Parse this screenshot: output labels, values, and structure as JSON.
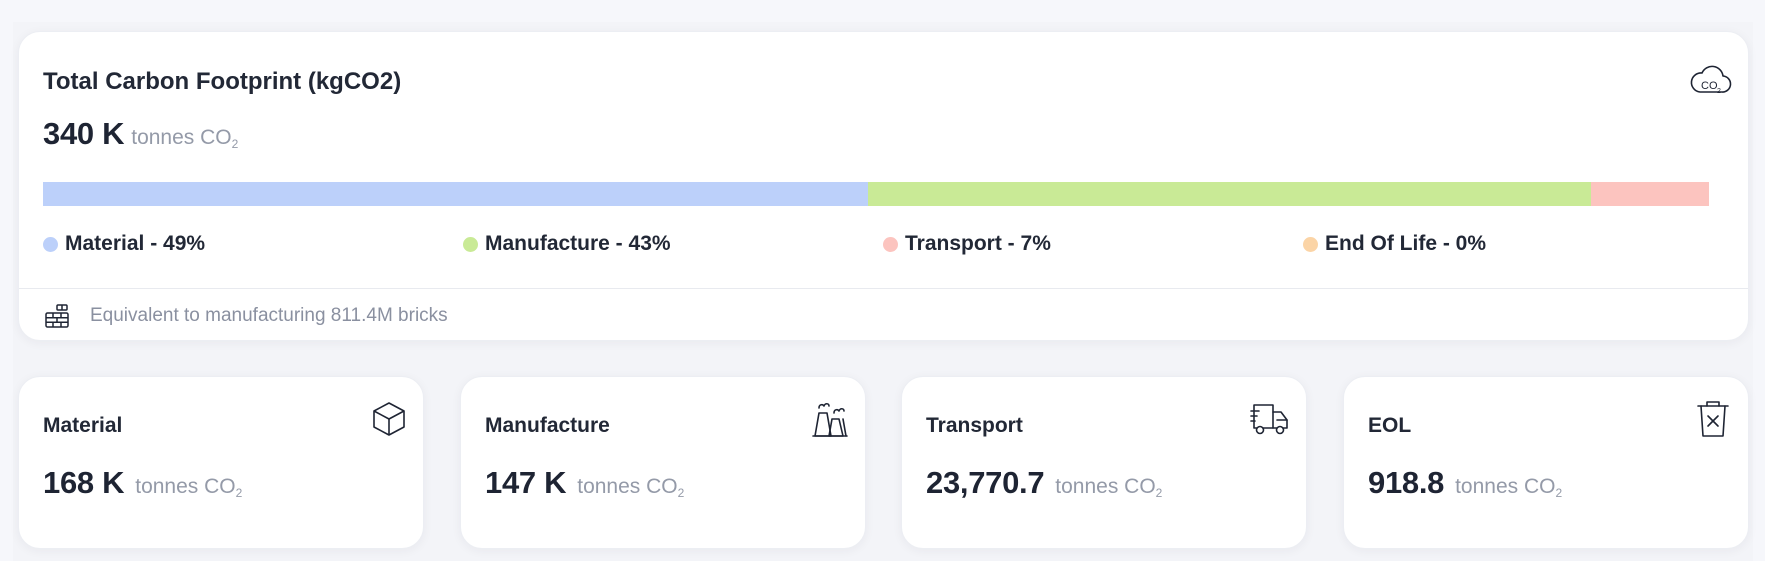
{
  "colors": {
    "material": "#bcd0fa",
    "manufacture": "#c9ea96",
    "transport": "#fcc4bf",
    "end_of_life": "#fbd4a6"
  },
  "total": {
    "title": "Total Carbon Footprint (kgCO2)",
    "icon": "co2-cloud-icon",
    "value": "340 K",
    "unit_prefix": "tonnes CO",
    "unit_sub": "2",
    "breakdown": [
      {
        "label": "Material - 49%",
        "fraction": 0.495,
        "color_key": "material"
      },
      {
        "label": "Manufacture - 43%",
        "fraction": 0.434,
        "color_key": "manufacture"
      },
      {
        "label": "Transport - 7%",
        "fraction": 0.071,
        "color_key": "transport"
      },
      {
        "label": "End Of Life - 0%",
        "fraction": 0.0,
        "color_key": "end_of_life"
      }
    ],
    "footer": {
      "icon": "brick-wall-icon",
      "text": "Equivalent to manufacturing 811.4M bricks"
    }
  },
  "cards": [
    {
      "title": "Material",
      "value": "168 K",
      "unit_prefix": "tonnes CO",
      "unit_sub": "2",
      "icon": "cube-icon"
    },
    {
      "title": "Manufacture",
      "value": "147 K",
      "unit_prefix": "tonnes CO",
      "unit_sub": "2",
      "icon": "factory-icon"
    },
    {
      "title": "Transport",
      "value": "23,770.7",
      "unit_prefix": "tonnes CO",
      "unit_sub": "2",
      "icon": "truck-icon"
    },
    {
      "title": "EOL",
      "value": "918.8",
      "unit_prefix": "tonnes CO",
      "unit_sub": "2",
      "icon": "trash-icon"
    }
  ]
}
